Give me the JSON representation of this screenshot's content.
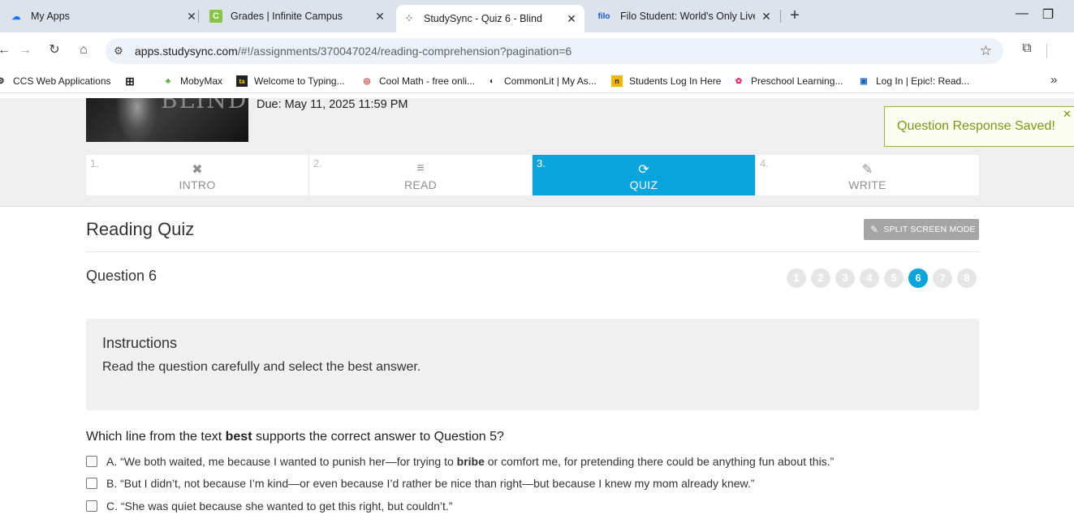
{
  "browser": {
    "tabs": [
      {
        "title": "My Apps",
        "favicon": "cloud-icon"
      },
      {
        "title": "Grades | Infinite Campus",
        "favicon": "infinite-campus-icon"
      },
      {
        "title": "StudySync - Quiz 6 - Blind",
        "favicon": "studysync-icon"
      },
      {
        "title": "Filo Student: World's Only Live",
        "favicon": "filo-icon"
      }
    ],
    "url_host": "apps.studysync.com",
    "url_path": "/#!/assignments/370047024/reading-comprehension?pagination=6",
    "bookmarks": [
      {
        "label": "CCS Web Applications",
        "icon": "apps-icon"
      },
      {
        "label": "MobyMax",
        "icon": "mobymax-icon"
      },
      {
        "label": "Welcome to Typing...",
        "icon": "typing-icon"
      },
      {
        "label": "Cool Math - free onli...",
        "icon": "coolmath-icon"
      },
      {
        "label": "CommonLit | My As...",
        "icon": "commonlit-icon"
      },
      {
        "label": "Students Log In Here",
        "icon": "students-icon"
      },
      {
        "label": "Preschool Learning...",
        "icon": "preschool-icon"
      },
      {
        "label": "Log In | Epic!: Read...",
        "icon": "epic-icon"
      }
    ]
  },
  "assignment": {
    "cover_word": "BLIND",
    "due": "Due: May 11, 2025 11:59 PM"
  },
  "toast": {
    "text": "Question Response Saved!",
    "close": "✕"
  },
  "steps": [
    {
      "num": "1.",
      "label": "INTRO",
      "icon": "✖"
    },
    {
      "num": "2.",
      "label": "READ",
      "icon": "≡"
    },
    {
      "num": "3.",
      "label": "QUIZ",
      "icon": "⟳"
    },
    {
      "num": "4.",
      "label": "WRITE",
      "icon": "✎"
    }
  ],
  "quiz": {
    "title": "Reading Quiz",
    "split_screen_label": "SPLIT SCREEN MODE",
    "question_label": "Question 6",
    "pages": [
      "1",
      "2",
      "3",
      "4",
      "5",
      "6",
      "7",
      "8"
    ],
    "current_page": "6",
    "instructions_heading": "Instructions",
    "instructions_text": "Read the question carefully and select the best answer.",
    "question_pre": "Which line from the text ",
    "question_bold": "best",
    "question_post": " supports the correct answer to Question 5?",
    "options": [
      {
        "pre": "A. “We both waited, me because I wanted to punish her—for trying to ",
        "bold": "bribe",
        "post": " or comfort me, for pretending there could be anything fun about this.”"
      },
      {
        "pre": "B. “But I didn’t, not because I’m kind—or even because I’d rather be nice than right—but because I knew my mom already knew.”",
        "bold": "",
        "post": ""
      },
      {
        "pre": "C. “She was quiet because she wanted to get this right, but couldn’t.”",
        "bold": "",
        "post": ""
      }
    ]
  },
  "colors": {
    "accent": "#09a4db",
    "toast_text": "#7a9a14",
    "toast_border": "#9fb23c"
  }
}
